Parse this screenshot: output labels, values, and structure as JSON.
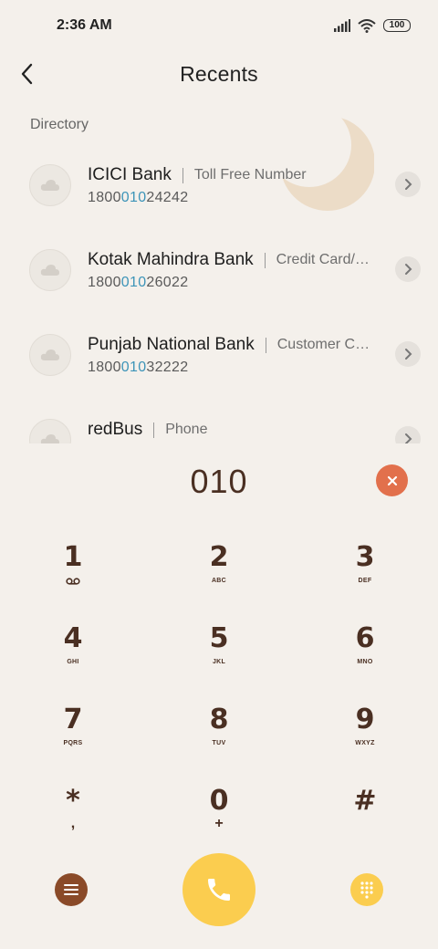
{
  "status_bar": {
    "time": "2:36 AM",
    "battery": "100",
    "icons": [
      "signal-icon",
      "wifi-icon",
      "battery-icon"
    ]
  },
  "header": {
    "title": "Recents",
    "back_icon": "back-arrow-icon"
  },
  "directory": {
    "label": "Directory",
    "items": [
      {
        "name": "ICICI Bank",
        "desc": "Toll Free Number",
        "num_pre": "1800",
        "num_match": "010",
        "num_post": "24242"
      },
      {
        "name": "Kotak Mahindra Bank",
        "desc": "Credit Card/…",
        "num_pre": "1800",
        "num_match": "010",
        "num_post": "26022"
      },
      {
        "name": "Punjab National Bank",
        "desc": "Customer C…",
        "num_pre": "1800",
        "num_match": "010",
        "num_post": "32222"
      },
      {
        "name": "redBus",
        "desc": "Phone",
        "num_pre": "",
        "num_match": "",
        "num_post": ""
      }
    ]
  },
  "dialer": {
    "dialed_number": "010",
    "keys": [
      {
        "digit": "1",
        "sub": ""
      },
      {
        "digit": "2",
        "sub": "ABC"
      },
      {
        "digit": "3",
        "sub": "DEF"
      },
      {
        "digit": "4",
        "sub": "GHI"
      },
      {
        "digit": "5",
        "sub": "JKL"
      },
      {
        "digit": "6",
        "sub": "MNO"
      },
      {
        "digit": "7",
        "sub": "PQRS"
      },
      {
        "digit": "8",
        "sub": "TUV"
      },
      {
        "digit": "9",
        "sub": "WXYZ"
      },
      {
        "digit": "*",
        "sub": ","
      },
      {
        "digit": "0",
        "sub": "+"
      },
      {
        "digit": "#",
        "sub": ""
      }
    ]
  },
  "colors": {
    "background": "#f4f0eb",
    "key_text": "#4a2f22",
    "highlight": "#3d94b8",
    "clear": "#e2704c",
    "call": "#fbcd4f",
    "menu": "#8a4a28"
  }
}
